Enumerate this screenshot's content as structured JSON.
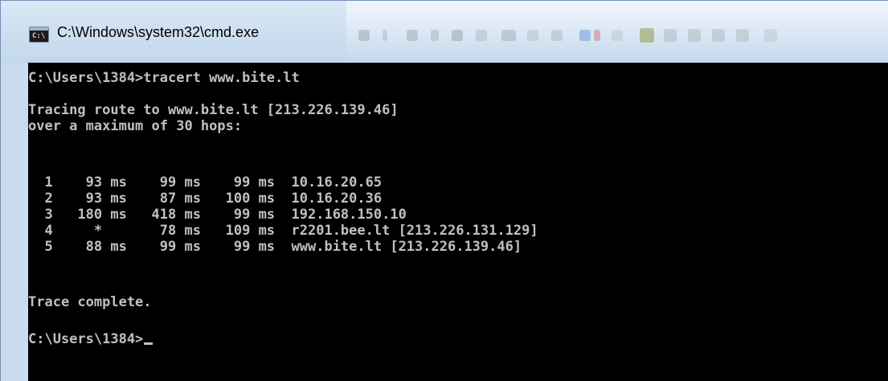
{
  "window": {
    "title": "C:\\Windows\\system32\\cmd.exe",
    "icon": "console-app-icon",
    "icon_text": "C:\\"
  },
  "console": {
    "lines": [
      "C:\\Users\\1384>tracert www.bite.lt",
      "",
      "Tracing route to www.bite.lt [213.226.139.46]",
      "over a maximum of 30 hops:",
      "",
      "  1    93 ms    99 ms    99 ms  10.16.20.65",
      "  2    93 ms    87 ms   100 ms  10.16.20.36",
      "  3   180 ms   418 ms    99 ms  192.168.150.10",
      "  4     *       78 ms   109 ms  r2201.bee.lt [213.226.131.129]",
      "  5    88 ms    99 ms    99 ms  www.bite.lt [213.226.139.46]",
      "",
      "Trace complete.",
      "",
      "C:\\Users\\1384>"
    ]
  },
  "colors": {
    "console_background": "#000000",
    "console_text": "#c0c0c0",
    "titlebar": "#cfe0f1"
  }
}
